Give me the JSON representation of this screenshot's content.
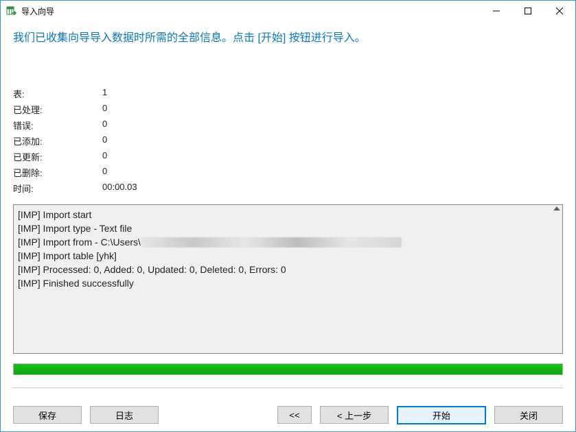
{
  "window": {
    "title": "导入向导"
  },
  "headline": "我们已收集向导导入数据时所需的全部信息。点击 [开始] 按钮进行导入。",
  "stats": {
    "table_label": "表:",
    "table_value": "1",
    "processed_label": "已处理:",
    "processed_value": "0",
    "errors_label": "错误:",
    "errors_value": "0",
    "added_label": "已添加:",
    "added_value": "0",
    "updated_label": "已更新:",
    "updated_value": "0",
    "deleted_label": "已删除:",
    "deleted_value": "0",
    "time_label": "时间:",
    "time_value": "00:00.03"
  },
  "log": {
    "l1": "[IMP] Import start",
    "l2": "[IMP] Import type - Text file",
    "l3_prefix": "[IMP] Import from - C:\\Users\\",
    "l4": "[IMP] Import table [yhk]",
    "l5": "[IMP] Processed: 0, Added: 0, Updated: 0, Deleted: 0, Errors: 0",
    "l6": "[IMP] Finished successfully"
  },
  "footer": {
    "save": "保存",
    "log": "日志",
    "first": "<<",
    "back": "< 上一步",
    "start": "开始",
    "close": "关闭"
  },
  "progress": {
    "percent": 100
  }
}
